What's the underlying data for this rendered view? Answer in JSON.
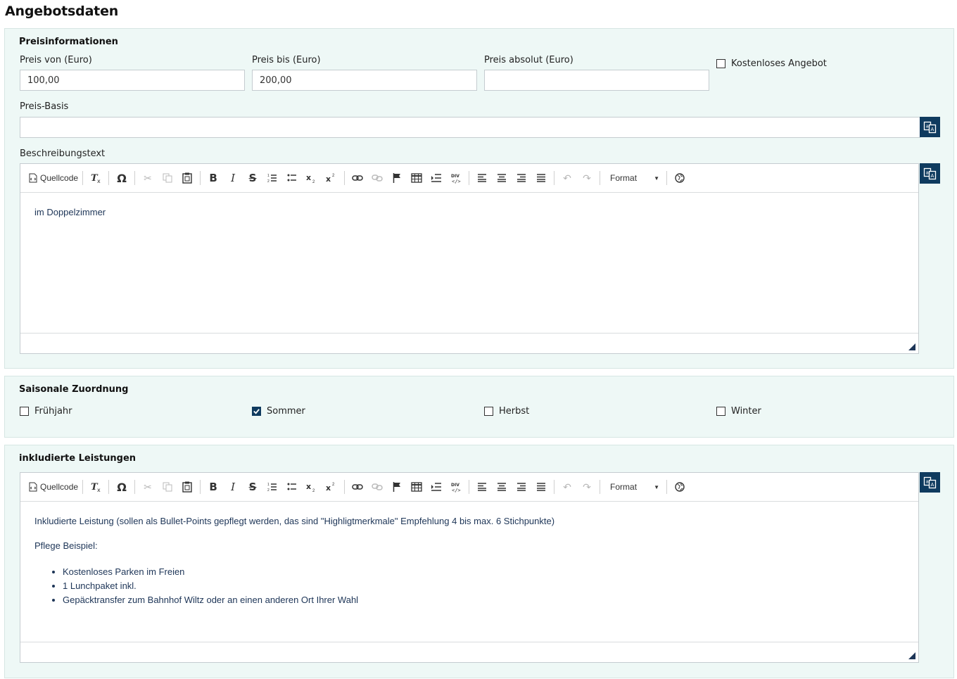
{
  "page": {
    "title": "Angebotsdaten"
  },
  "price": {
    "section_title": "Preisinformationen",
    "from": {
      "label": "Preis von (Euro)",
      "value": "100,00"
    },
    "to": {
      "label": "Preis bis (Euro)",
      "value": "200,00"
    },
    "absolute": {
      "label": "Preis absolut (Euro)",
      "value": ""
    },
    "free_offer": {
      "label": "Kostenloses Angebot",
      "checked": false
    },
    "basis": {
      "label": "Preis-Basis",
      "value": ""
    },
    "description": {
      "label": "Beschreibungstext",
      "content": "im Doppelzimmer"
    }
  },
  "toolbar": {
    "source_label": "Quellcode",
    "format_label": "Format"
  },
  "season": {
    "section_title": "Saisonale Zuordnung",
    "options": [
      {
        "label": "Frühjahr",
        "checked": false
      },
      {
        "label": "Sommer",
        "checked": true
      },
      {
        "label": "Herbst",
        "checked": false
      },
      {
        "label": "Winter",
        "checked": false
      }
    ]
  },
  "services": {
    "section_title": "inkludierte Leistungen",
    "paragraph1": "Inkludierte Leistung (sollen als Bullet-Points gepflegt werden, das sind \"Highligtmerkmale\" Empfehlung 4 bis max. 6 Stichpunkte)",
    "paragraph2": "Pflege Beispiel:",
    "items": [
      "Kostenloses Parken im Freien",
      "1 Lunchpaket inkl.",
      "Gepäcktransfer zum Bahnhof Wiltz oder an einen anderen Ort Ihrer Wahl"
    ]
  },
  "colors": {
    "accent": "#0f3b5f",
    "panel_bg": "#eef8f6",
    "text_blue": "#1d3557"
  }
}
